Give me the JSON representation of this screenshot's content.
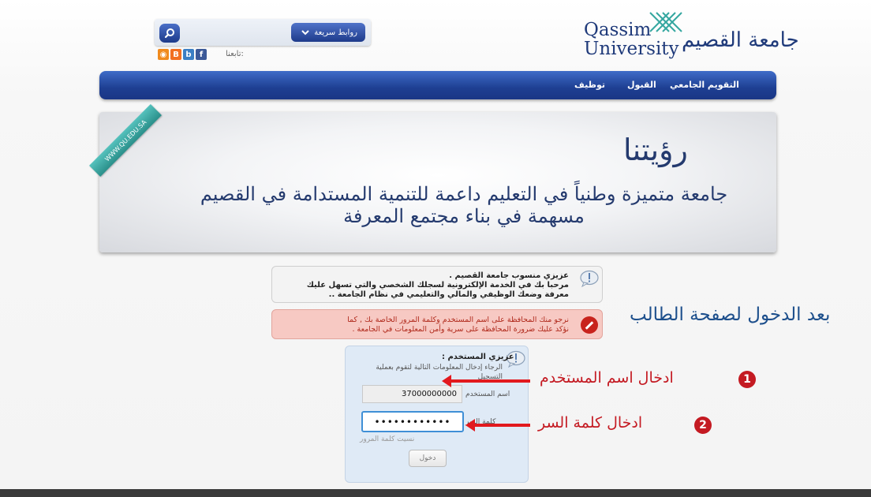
{
  "header": {
    "quick_links_label": "روابط سريعة",
    "follow_label": "تابعنا:",
    "social_icons": [
      "facebook-icon",
      "blogger-icon",
      "blogger-alt-icon",
      "rss-icon"
    ],
    "logo": {
      "latin_line1": "Qassim",
      "latin_line2": "University",
      "arabic": "جامعة القصيم"
    }
  },
  "nav": {
    "items": [
      "التقويم الجامعي",
      "القبول",
      "توظيف"
    ]
  },
  "banner": {
    "ribbon": "WWW.QU.EDU.SA",
    "vision_title": "رؤيتنا",
    "vision_text": "جامعة متميزة وطنياً في التعليم داعمة للتنمية المستدامة في القصيم مسهمة في بناء مجتمع المعرفة"
  },
  "messages": {
    "info_line1": "عزيزي منسوب جامعة القصيم .",
    "info_line2": "مرحبا بك في الخدمة الإلكترونية لسجلك الشخصي والتي تسهل عليك",
    "info_line3": "معرفة وضعك الوظيفي والمالي والتعليمي في نظام الجامعة ..",
    "warn_line1": "نرجو منك المحافظة على اسم المستخدم وكلمة المرور الخاصة بك , كما",
    "warn_line2": "نؤكد عليك ضرورة المحافظة على سرية وأمن المعلومات في الجامعة ."
  },
  "login": {
    "dear_user": "عزيزي المستخدم :",
    "instruction": "الرجاء إدخال المعلومات التالية لتقوم بعملية التسجيل",
    "username_label": "اسم المستخدم",
    "username_value": "37000000000",
    "password_label": "كلمة السر",
    "password_value": "••••••••••••",
    "forgot_label": "نسيت كلمة المرور",
    "login_button": "دخول"
  },
  "annotations": {
    "after_login": "بعد الدخول لصفحة الطالب",
    "step1_num": "1",
    "step1_text": "ادخال اسم المستخدم",
    "step2_num": "2",
    "step2_text": "ادخال كلمة السر"
  },
  "colors": {
    "nav_blue": "#1e3f92",
    "accent_red": "#c41a22",
    "annotation_blue": "#1d4f8c",
    "ribbon_teal": "#2a8f8a"
  }
}
